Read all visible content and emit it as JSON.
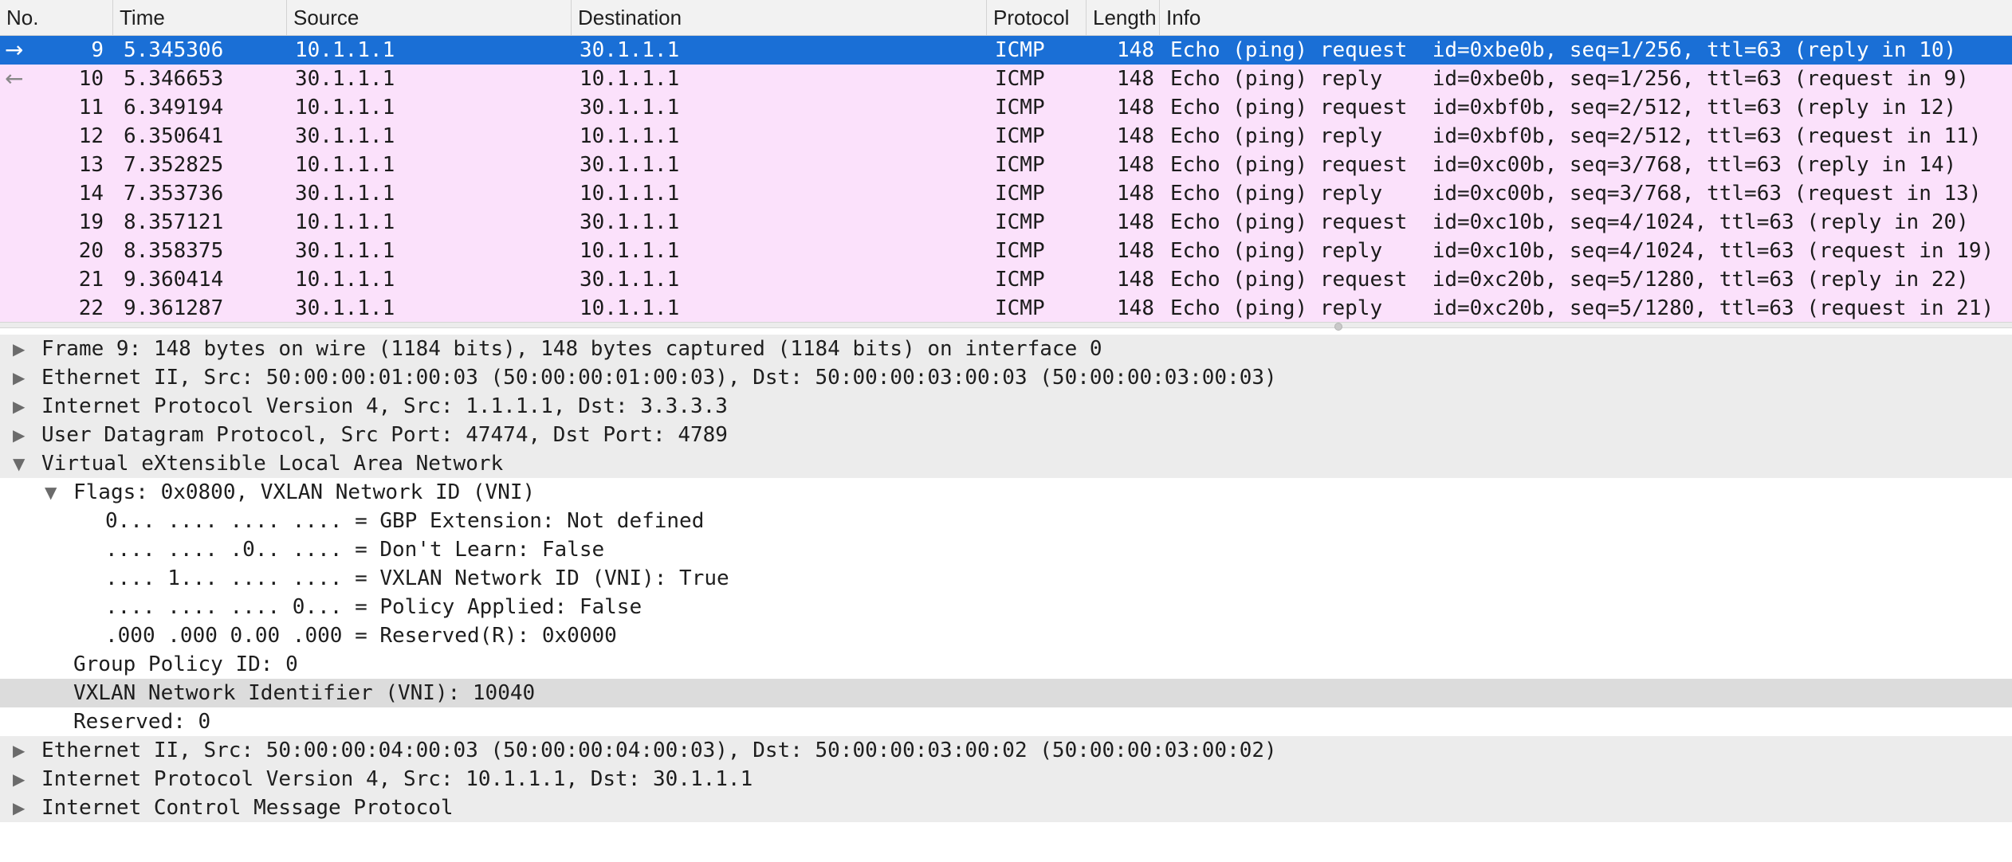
{
  "packet_list": {
    "columns": [
      "No.",
      "Time",
      "Source",
      "Destination",
      "Protocol",
      "Length",
      "Info"
    ],
    "rows": [
      {
        "no": "9",
        "time": "5.345306",
        "source": "10.1.1.1",
        "destination": "30.1.1.1",
        "protocol": "ICMP",
        "length": "148",
        "info": "Echo (ping) request  id=0xbe0b, seq=1/256, ttl=63 (reply in 10)",
        "direction": "→"
      },
      {
        "no": "10",
        "time": "5.346653",
        "source": "30.1.1.1",
        "destination": "10.1.1.1",
        "protocol": "ICMP",
        "length": "148",
        "info": "Echo (ping) reply    id=0xbe0b, seq=1/256, ttl=63 (request in 9)",
        "direction": "←"
      },
      {
        "no": "11",
        "time": "6.349194",
        "source": "10.1.1.1",
        "destination": "30.1.1.1",
        "protocol": "ICMP",
        "length": "148",
        "info": "Echo (ping) request  id=0xbf0b, seq=2/512, ttl=63 (reply in 12)",
        "direction": ""
      },
      {
        "no": "12",
        "time": "6.350641",
        "source": "30.1.1.1",
        "destination": "10.1.1.1",
        "protocol": "ICMP",
        "length": "148",
        "info": "Echo (ping) reply    id=0xbf0b, seq=2/512, ttl=63 (request in 11)",
        "direction": ""
      },
      {
        "no": "13",
        "time": "7.352825",
        "source": "10.1.1.1",
        "destination": "30.1.1.1",
        "protocol": "ICMP",
        "length": "148",
        "info": "Echo (ping) request  id=0xc00b, seq=3/768, ttl=63 (reply in 14)",
        "direction": ""
      },
      {
        "no": "14",
        "time": "7.353736",
        "source": "30.1.1.1",
        "destination": "10.1.1.1",
        "protocol": "ICMP",
        "length": "148",
        "info": "Echo (ping) reply    id=0xc00b, seq=3/768, ttl=63 (request in 13)",
        "direction": ""
      },
      {
        "no": "19",
        "time": "8.357121",
        "source": "10.1.1.1",
        "destination": "30.1.1.1",
        "protocol": "ICMP",
        "length": "148",
        "info": "Echo (ping) request  id=0xc10b, seq=4/1024, ttl=63 (reply in 20)",
        "direction": ""
      },
      {
        "no": "20",
        "time": "8.358375",
        "source": "30.1.1.1",
        "destination": "10.1.1.1",
        "protocol": "ICMP",
        "length": "148",
        "info": "Echo (ping) reply    id=0xc10b, seq=4/1024, ttl=63 (request in 19)",
        "direction": ""
      },
      {
        "no": "21",
        "time": "9.360414",
        "source": "10.1.1.1",
        "destination": "30.1.1.1",
        "protocol": "ICMP",
        "length": "148",
        "info": "Echo (ping) request  id=0xc20b, seq=5/1280, ttl=63 (reply in 22)",
        "direction": ""
      },
      {
        "no": "22",
        "time": "9.361287",
        "source": "30.1.1.1",
        "destination": "10.1.1.1",
        "protocol": "ICMP",
        "length": "148",
        "info": "Echo (ping) reply    id=0xc20b, seq=5/1280, ttl=63 (request in 21)",
        "direction": ""
      }
    ],
    "selected_row": 0
  },
  "detail_tree": [
    {
      "text": "Frame 9: 148 bytes on wire (1184 bits), 148 bytes captured (1184 bits) on interface 0",
      "depth": 0,
      "expander": "collapsed",
      "style": "group"
    },
    {
      "text": "Ethernet II, Src: 50:00:00:01:00:03 (50:00:00:01:00:03), Dst: 50:00:00:03:00:03 (50:00:00:03:00:03)",
      "depth": 0,
      "expander": "collapsed",
      "style": "group"
    },
    {
      "text": "Internet Protocol Version 4, Src: 1.1.1.1, Dst: 3.3.3.3",
      "depth": 0,
      "expander": "collapsed",
      "style": "group"
    },
    {
      "text": "User Datagram Protocol, Src Port: 47474, Dst Port: 4789",
      "depth": 0,
      "expander": "collapsed",
      "style": "group"
    },
    {
      "text": "Virtual eXtensible Local Area Network",
      "depth": 0,
      "expander": "expanded",
      "style": "group"
    },
    {
      "text": "Flags: 0x0800, VXLAN Network ID (VNI)",
      "depth": 1,
      "expander": "expanded",
      "style": "plain"
    },
    {
      "text": "0... .... .... .... = GBP Extension: Not defined",
      "depth": 2,
      "expander": "none",
      "style": "plain"
    },
    {
      "text": ".... .... .0.. .... = Don't Learn: False",
      "depth": 2,
      "expander": "none",
      "style": "plain"
    },
    {
      "text": ".... 1... .... .... = VXLAN Network ID (VNI): True",
      "depth": 2,
      "expander": "none",
      "style": "plain"
    },
    {
      "text": ".... .... .... 0... = Policy Applied: False",
      "depth": 2,
      "expander": "none",
      "style": "plain"
    },
    {
      "text": ".000 .000 0.00 .000 = Reserved(R): 0x0000",
      "depth": 2,
      "expander": "none",
      "style": "plain"
    },
    {
      "text": "Group Policy ID: 0",
      "depth": 1,
      "expander": "none",
      "style": "plain"
    },
    {
      "text": "VXLAN Network Identifier (VNI): 10040",
      "depth": 1,
      "expander": "none",
      "style": "highlight"
    },
    {
      "text": "Reserved: 0",
      "depth": 1,
      "expander": "none",
      "style": "plain"
    },
    {
      "text": "Ethernet II, Src: 50:00:00:04:00:03 (50:00:00:04:00:03), Dst: 50:00:00:03:00:02 (50:00:00:03:00:02)",
      "depth": 0,
      "expander": "collapsed",
      "style": "group"
    },
    {
      "text": "Internet Protocol Version 4, Src: 10.1.1.1, Dst: 30.1.1.1",
      "depth": 0,
      "expander": "collapsed",
      "style": "group"
    },
    {
      "text": "Internet Control Message Protocol",
      "depth": 0,
      "expander": "collapsed",
      "style": "group"
    }
  ],
  "icons": {
    "collapsed": "triangle-right-icon",
    "expanded": "triangle-down-icon",
    "outgoing": "arrow-right-icon",
    "incoming": "arrow-left-icon"
  },
  "colors": {
    "selected_row": "#1a6fd6",
    "icmp_row": "#fbe1fb",
    "tree_group": "#ececec",
    "tree_highlight": "#dcdcdc"
  }
}
